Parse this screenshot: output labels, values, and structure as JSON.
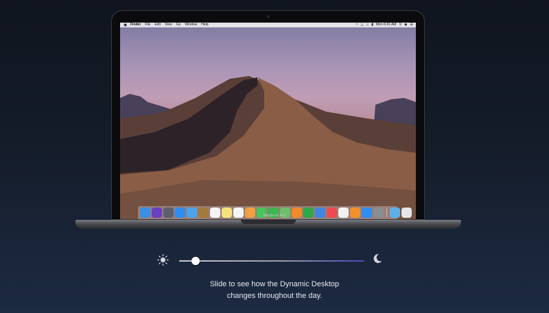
{
  "menubar": {
    "items": [
      "Finder",
      "File",
      "Edit",
      "View",
      "Go",
      "Window",
      "Help"
    ],
    "clock": "Mon 6:41 AM"
  },
  "laptop": {
    "model_label": "MacBook Pro"
  },
  "dock": {
    "apps": [
      {
        "icon": "finder-icon",
        "color": "#3a8ee6"
      },
      {
        "icon": "siri-icon",
        "color": "#6a3fc0"
      },
      {
        "icon": "launchpad-icon",
        "color": "#5a6070"
      },
      {
        "icon": "safari-icon",
        "color": "#2f8cf0"
      },
      {
        "icon": "mail-icon",
        "color": "#4aa3f0"
      },
      {
        "icon": "contacts-icon",
        "color": "#a47a3c"
      },
      {
        "icon": "calendar-icon",
        "color": "#f4f4f4"
      },
      {
        "icon": "notes-icon",
        "color": "#f6e27a"
      },
      {
        "icon": "reminders-icon",
        "color": "#f5f5f5"
      },
      {
        "icon": "photos-icon",
        "color": "#f0a040"
      },
      {
        "icon": "messages-icon",
        "color": "#47c45a"
      },
      {
        "icon": "facetime-icon",
        "color": "#3ab74e"
      },
      {
        "icon": "maps-icon",
        "color": "#6cc06a"
      },
      {
        "icon": "pages-icon",
        "color": "#f08a2a"
      },
      {
        "icon": "numbers-icon",
        "color": "#2fa84a"
      },
      {
        "icon": "keynote-icon",
        "color": "#3f86e0"
      },
      {
        "icon": "news-icon",
        "color": "#f04a50"
      },
      {
        "icon": "music-icon",
        "color": "#f2f2f2"
      },
      {
        "icon": "books-icon",
        "color": "#f2902a"
      },
      {
        "icon": "app-store-icon",
        "color": "#2e8ef2"
      },
      {
        "icon": "system-preferences-icon",
        "color": "#8a8d92"
      }
    ],
    "trailing": [
      {
        "icon": "downloads-folder-icon",
        "color": "#5fb0ea"
      },
      {
        "icon": "trash-icon",
        "color": "#e6e6e8"
      }
    ]
  },
  "slider": {
    "position": 0.09,
    "colors": {
      "start": "#c9cbd0",
      "end": "#4b47b8"
    }
  },
  "caption": {
    "line1": "Slide to see how the Dynamic Desktop",
    "line2": "changes throughout the day."
  }
}
